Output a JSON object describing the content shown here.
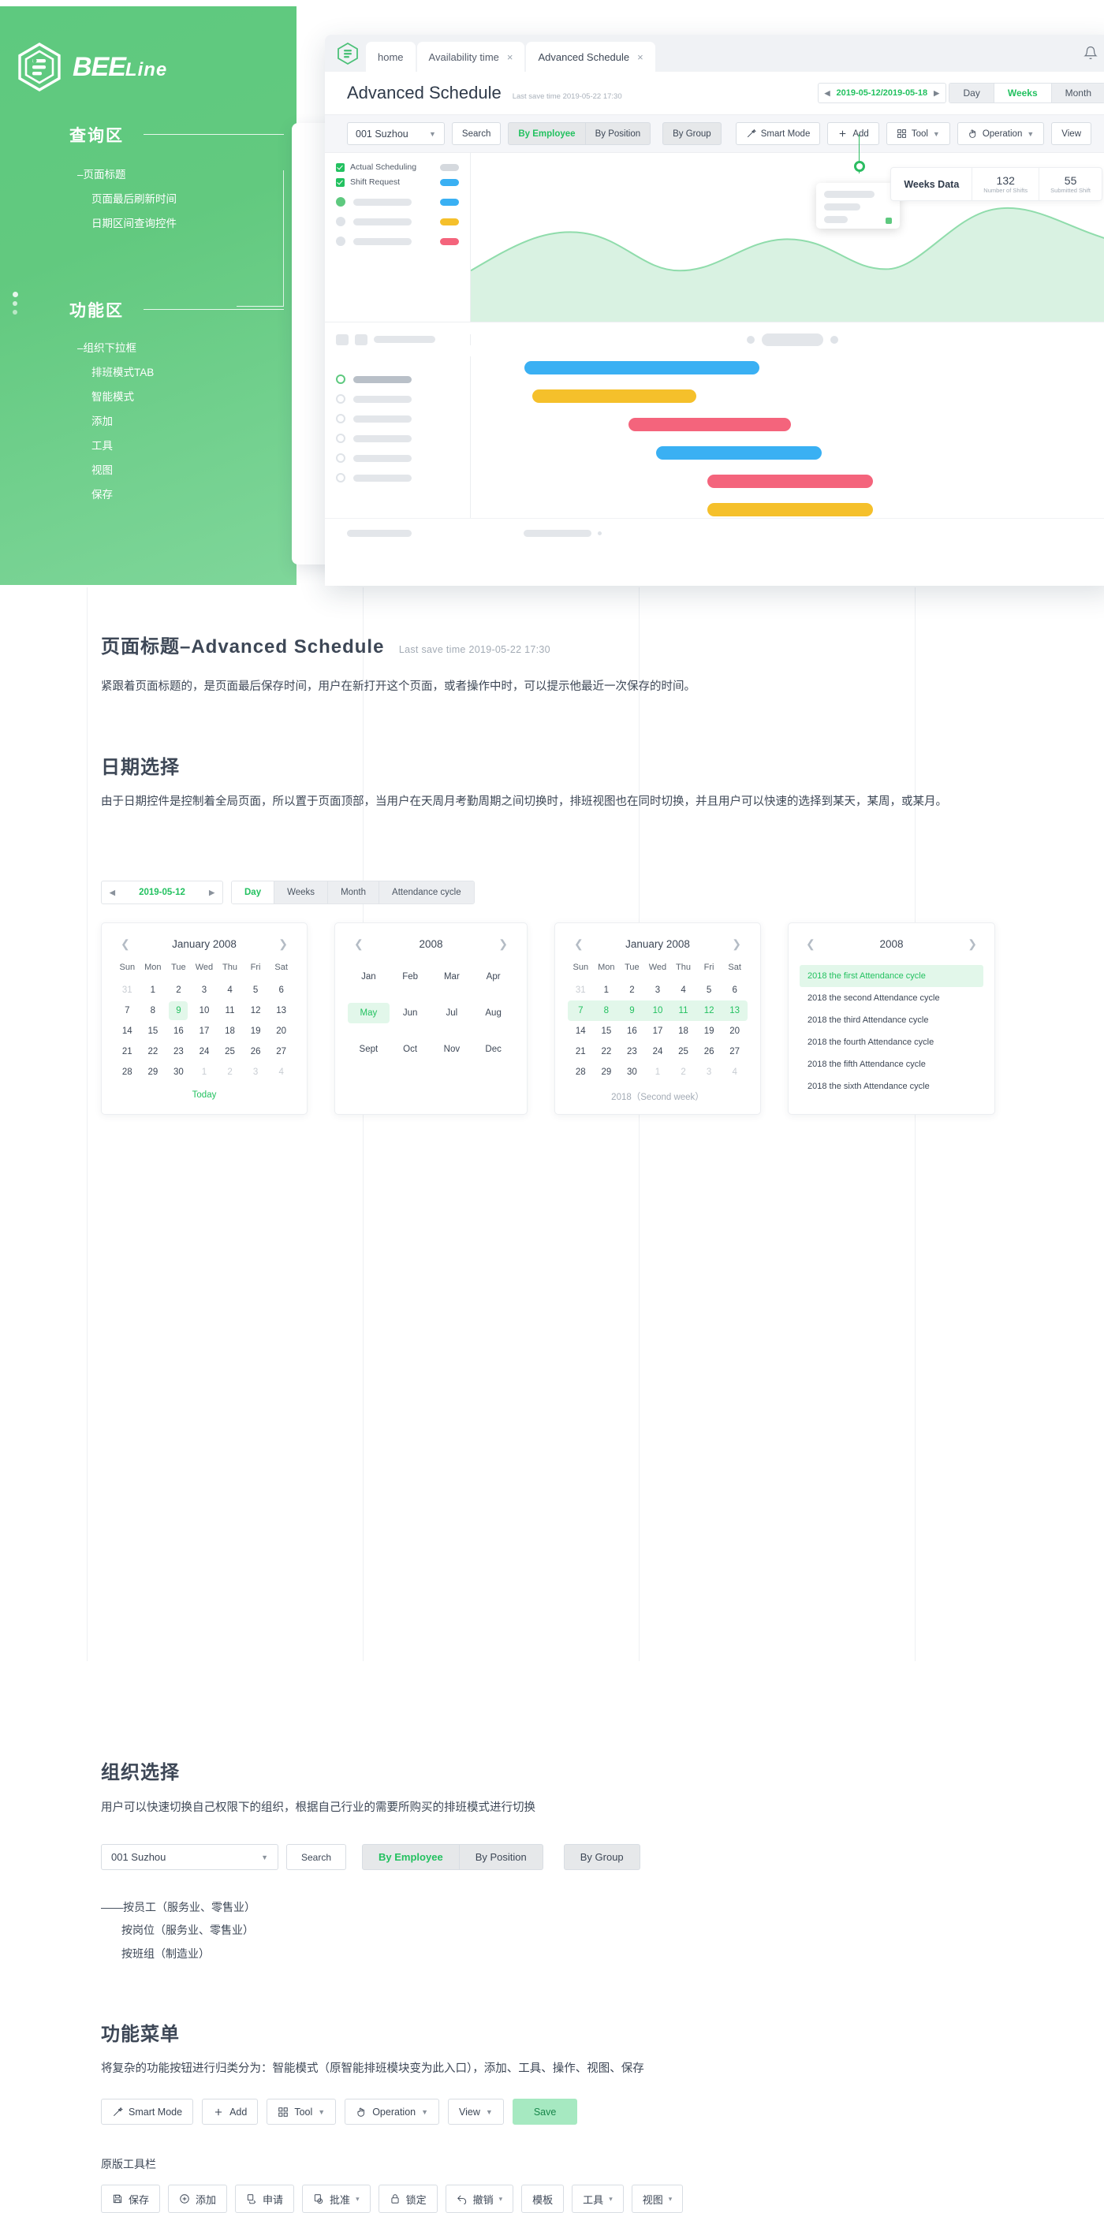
{
  "brand": {
    "name": "BEE",
    "suffix": "Line",
    "logo_icon": "beeline-hex-logo"
  },
  "hero": {
    "sections": [
      {
        "title": "查询区",
        "items": [
          "–页面标题",
          "页面最后刷新时间",
          "日期区间查询控件"
        ]
      },
      {
        "title": "功能区",
        "items": [
          "–组织下拉框",
          "排班模式TAB",
          "智能模式",
          "添加",
          "工具",
          "视图",
          "保存"
        ]
      }
    ]
  },
  "appwin": {
    "tabs": [
      {
        "label": "home",
        "closable": false,
        "active": false
      },
      {
        "label": "Availability time",
        "closable": true,
        "active": false
      },
      {
        "label": "Advanced Schedule",
        "closable": true,
        "active": true
      }
    ],
    "close_glyph": "×",
    "bell_icon": "notification-bell-icon",
    "title": "Advanced Schedule",
    "save_time": "Last save time 2019-05-22 17:30",
    "date_range": "2019-05-12/2019-05-18",
    "view_segments": [
      {
        "label": "Day",
        "active": false
      },
      {
        "label": "Weeks",
        "active": true
      },
      {
        "label": "Month",
        "active": false
      }
    ],
    "org_value": "001 Suzhou",
    "search_label": "Search",
    "mode_tabs": [
      {
        "label": "By Employee",
        "active": true
      },
      {
        "label": "By Position",
        "active": false
      }
    ],
    "group_tab": "By Group",
    "tools": [
      {
        "label": "Smart Mode",
        "icon": "magic-wand-icon",
        "caret": false
      },
      {
        "label": "Add",
        "icon": "plus-icon",
        "caret": false
      },
      {
        "label": "Tool",
        "icon": "grid-squares-icon",
        "caret": true
      },
      {
        "label": "Operation",
        "icon": "hand-pointer-icon",
        "caret": true
      },
      {
        "label": "View",
        "icon": "",
        "caret": false
      }
    ],
    "checkboxes": [
      {
        "label": "Actual Scheduling",
        "checked": true,
        "swatch": "#d5d9de"
      },
      {
        "label": "Shift Request",
        "checked": true,
        "swatch": "#3ab0f3"
      }
    ],
    "stats": {
      "panel_label": "Weeks Data",
      "items": [
        {
          "value": "132",
          "label": "Number of Shifts"
        },
        {
          "value": "55",
          "label": "Submitted Shift"
        }
      ]
    },
    "legend_colors": [
      "#3ab0f3",
      "#f5c02b",
      "#f4647c"
    ],
    "gantt_bar_colors": [
      "#3ab0f3",
      "#f5c02b",
      "#f4647c",
      "#3ab0f3",
      "#f4647c",
      "#f5c02b"
    ]
  },
  "doc": {
    "title_cn": "页面标题–Advanced Schedule",
    "title_time": "Last save time 2019-05-22 17:30",
    "title_desc": "紧跟着页面标题的，是页面最后保存时间，用户在新打开这个页面，或者操作中时，可以提示他最近一次保存的时间。",
    "date_section": {
      "heading": "日期选择",
      "desc": "由于日期控件是控制着全局页面，所以置于页面顶部，当用户在天周月考勤周期之间切换时，排班视图也在同时切换，并且用户可以快速的选择到某天，某周，或某月。",
      "date_value": "2019-05-12",
      "segments": [
        {
          "label": "Day",
          "active": true
        },
        {
          "label": "Weeks",
          "active": false
        },
        {
          "label": "Month",
          "active": false
        },
        {
          "label": "Attendance cycle",
          "active": false
        }
      ]
    },
    "calendars": {
      "weekdays": [
        "Sun",
        "Mon",
        "Tue",
        "Wed",
        "Thu",
        "Fri",
        "Sat"
      ],
      "day_picker": {
        "header": "January  2008",
        "weeks": [
          [
            {
              "d": "31",
              "out": true
            },
            {
              "d": "1"
            },
            {
              "d": "2"
            },
            {
              "d": "3"
            },
            {
              "d": "4"
            },
            {
              "d": "5"
            },
            {
              "d": "6"
            }
          ],
          [
            {
              "d": "7"
            },
            {
              "d": "8"
            },
            {
              "d": "9",
              "sel": true
            },
            {
              "d": "10"
            },
            {
              "d": "11"
            },
            {
              "d": "12"
            },
            {
              "d": "13"
            }
          ],
          [
            {
              "d": "14"
            },
            {
              "d": "15"
            },
            {
              "d": "16"
            },
            {
              "d": "17"
            },
            {
              "d": "18"
            },
            {
              "d": "19"
            },
            {
              "d": "20"
            }
          ],
          [
            {
              "d": "21"
            },
            {
              "d": "22"
            },
            {
              "d": "23"
            },
            {
              "d": "24"
            },
            {
              "d": "25"
            },
            {
              "d": "26"
            },
            {
              "d": "27"
            }
          ],
          [
            {
              "d": "28"
            },
            {
              "d": "29"
            },
            {
              "d": "30"
            },
            {
              "d": "1",
              "out": true
            },
            {
              "d": "2",
              "out": true
            },
            {
              "d": "3",
              "out": true
            },
            {
              "d": "4",
              "out": true
            }
          ]
        ],
        "footer": "Today"
      },
      "month_picker": {
        "header": "2008",
        "months": [
          "Jan",
          "Feb",
          "Mar",
          "Apr",
          "May",
          "Jun",
          "Jul",
          "Aug",
          "Sept",
          "Oct",
          "Nov",
          "Dec"
        ],
        "selected": "May"
      },
      "week_picker": {
        "header": "January  2008",
        "footer": "2018（Second week）",
        "selected_row": 1
      },
      "cycle_picker": {
        "header": "2008",
        "items": [
          "2018 the first Attendance cycle",
          "2018 the second Attendance cycle",
          "2018 the third Attendance cycle",
          "2018 the fourth Attendance cycle",
          "2018 the fifth Attendance cycle",
          "2018 the sixth Attendance cycle"
        ],
        "selected_index": 0
      }
    },
    "org_section": {
      "heading": "组织选择",
      "desc": "用户可以快速切换自己权限下的组织，根据自己行业的需要所购买的排班模式进行切换",
      "select_value": "001 Suzhou",
      "search_label": "Search",
      "tabs": [
        {
          "label": "By Employee",
          "active": true
        },
        {
          "label": "By Position",
          "active": false
        }
      ],
      "group_tab": "By Group",
      "notes": [
        "——按员工（服务业、零售业）",
        "按岗位（服务业、零售业）",
        "按班组（制造业）"
      ]
    },
    "func_section": {
      "heading": "功能菜单",
      "desc": "将复杂的功能按钮进行归类分为：智能模式（原智能排班模块变为此入口），添加、工具、操作、视图、保存",
      "buttons": [
        {
          "label": "Smart Mode",
          "icon": "magic-wand-icon",
          "caret": false,
          "primary": false
        },
        {
          "label": "Add",
          "icon": "plus-icon",
          "caret": false,
          "primary": false
        },
        {
          "label": "Tool",
          "icon": "grid-squares-icon",
          "caret": true,
          "primary": false
        },
        {
          "label": "Operation",
          "icon": "hand-pointer-icon",
          "caret": true,
          "primary": false
        },
        {
          "label": "View",
          "icon": "",
          "caret": true,
          "primary": false
        },
        {
          "label": "Save",
          "icon": "",
          "caret": false,
          "primary": true
        }
      ],
      "legacy_heading": "原版工具栏",
      "legacy_buttons": [
        {
          "label": "保存",
          "icon": "save-floppy-icon",
          "caret": false
        },
        {
          "label": "添加",
          "icon": "plus-circle-icon",
          "caret": false
        },
        {
          "label": "申请",
          "icon": "apply-hand-icon",
          "caret": false
        },
        {
          "label": "批准",
          "icon": "approve-check-icon",
          "caret": true
        },
        {
          "label": "锁定",
          "icon": "lock-icon",
          "caret": false
        },
        {
          "label": "撤销",
          "icon": "undo-arrow-icon",
          "caret": true
        },
        {
          "label": "模板",
          "icon": "",
          "caret": false
        },
        {
          "label": "工具",
          "icon": "",
          "caret": true
        },
        {
          "label": "视图",
          "icon": "",
          "caret": true
        }
      ]
    }
  },
  "colors": {
    "brand_green": "#5ec97f",
    "accent_green": "#23c160",
    "tint_green": "#e2f7ea"
  }
}
